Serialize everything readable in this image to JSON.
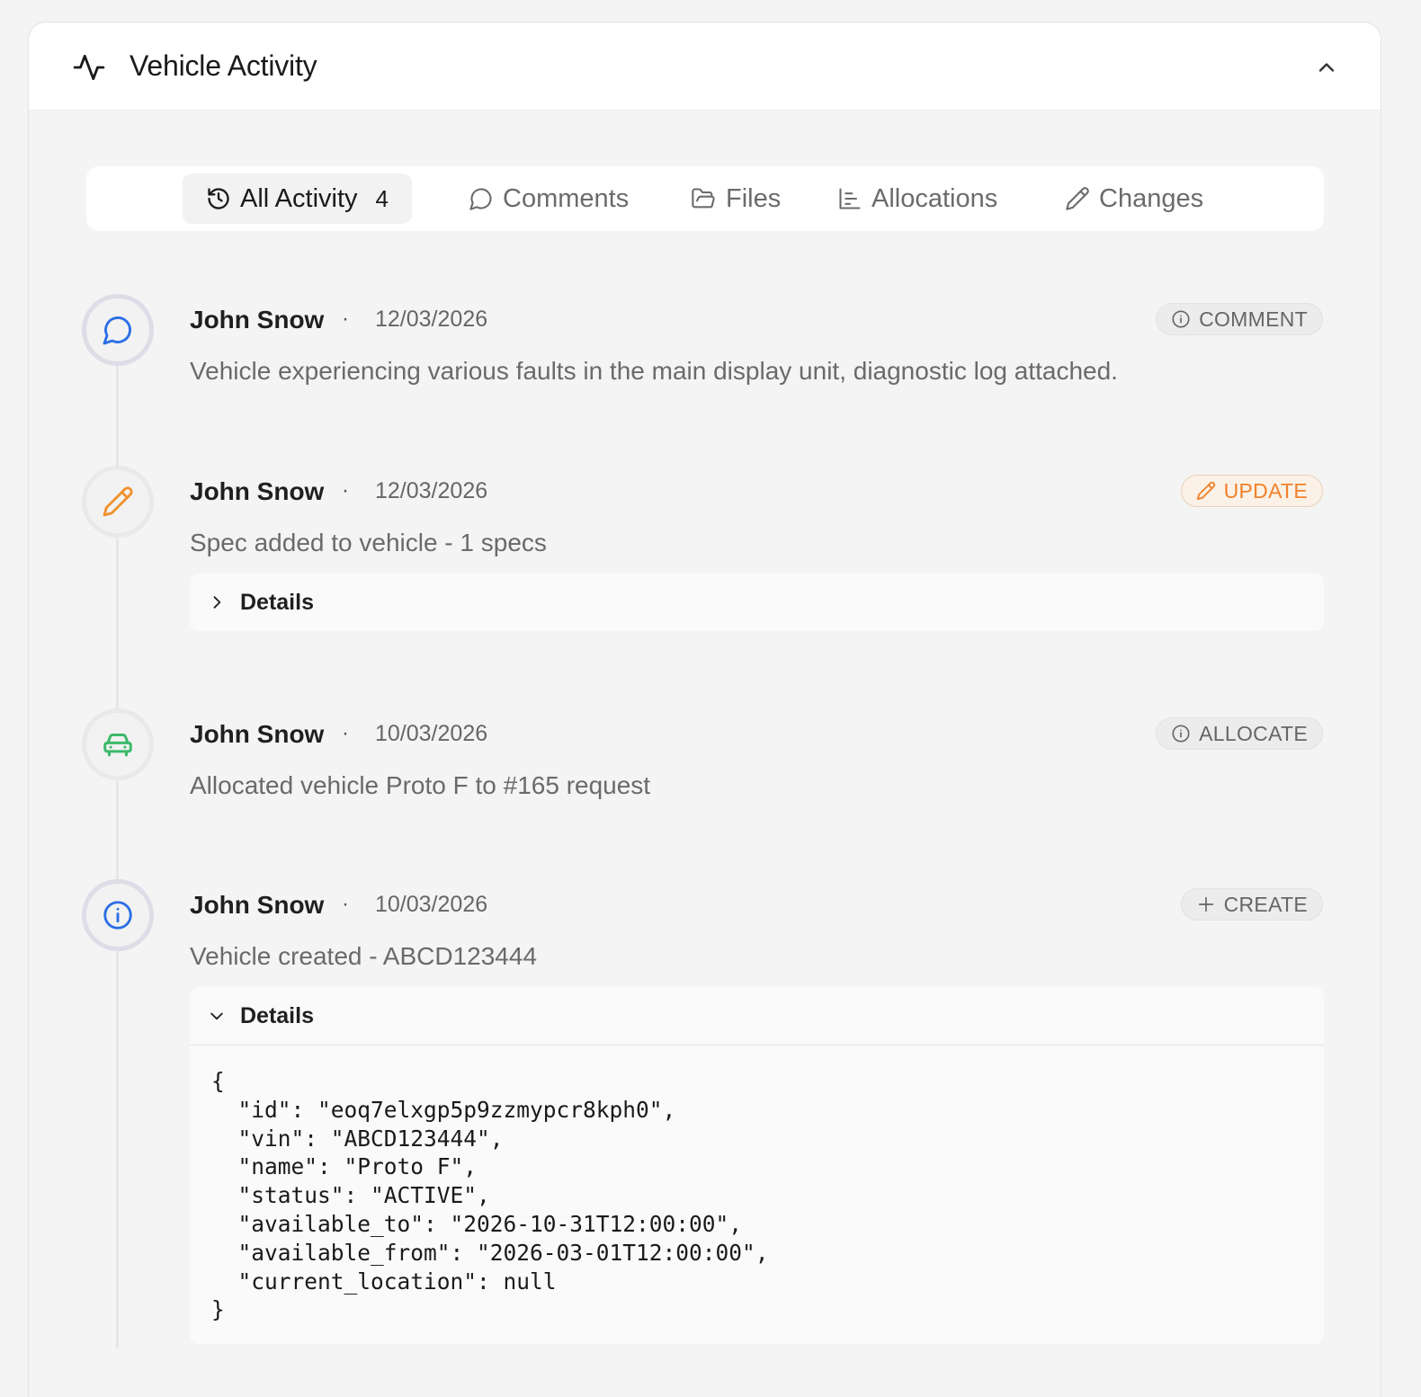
{
  "header": {
    "title": "Vehicle Activity"
  },
  "tabs": [
    {
      "label": "All Activity",
      "count": "4",
      "icon": "history-icon",
      "active": true
    },
    {
      "label": "Comments",
      "icon": "message-icon"
    },
    {
      "label": "Files",
      "icon": "folder-icon"
    },
    {
      "label": "Allocations",
      "icon": "gantt-icon"
    },
    {
      "label": "Changes",
      "icon": "pencil-icon"
    }
  ],
  "entries": [
    {
      "author": "John Snow",
      "separator": "·",
      "date": "12/03/2026",
      "badge": "COMMENT",
      "badge_icon": "info-icon",
      "message": "Vehicle experiencing various faults in the main display unit, diagnostic log attached.",
      "avatar_icon": "message-icon",
      "icon_color": "#2b6ee6"
    },
    {
      "author": "John Snow",
      "separator": "·",
      "date": "12/03/2026",
      "badge": "UPDATE",
      "badge_icon": "pencil-icon",
      "message": "Spec added to vehicle - 1 specs",
      "details_label": "Details",
      "details_expanded": false,
      "avatar_icon": "pencil-icon",
      "icon_color": "#f0912e"
    },
    {
      "author": "John Snow",
      "separator": "·",
      "date": "10/03/2026",
      "badge": "ALLOCATE",
      "badge_icon": "info-icon",
      "message": "Allocated vehicle Proto F to #165 request",
      "avatar_icon": "car-icon",
      "icon_color": "#3cb96a"
    },
    {
      "author": "John Snow",
      "separator": "·",
      "date": "10/03/2026",
      "badge": "CREATE",
      "badge_icon": "plus-icon",
      "message": "Vehicle created - ABCD123444",
      "details_label": "Details",
      "details_expanded": true,
      "details_json": "{\n  \"id\": \"eoq7elxgp5p9zzmypcr8kph0\",\n  \"vin\": \"ABCD123444\",\n  \"name\": \"Proto F\",\n  \"status\": \"ACTIVE\",\n  \"available_to\": \"2026-10-31T12:00:00\",\n  \"available_from\": \"2026-03-01T12:00:00\",\n  \"current_location\": null\n}",
      "avatar_icon": "info-icon",
      "icon_color": "#2b6ee6"
    }
  ]
}
